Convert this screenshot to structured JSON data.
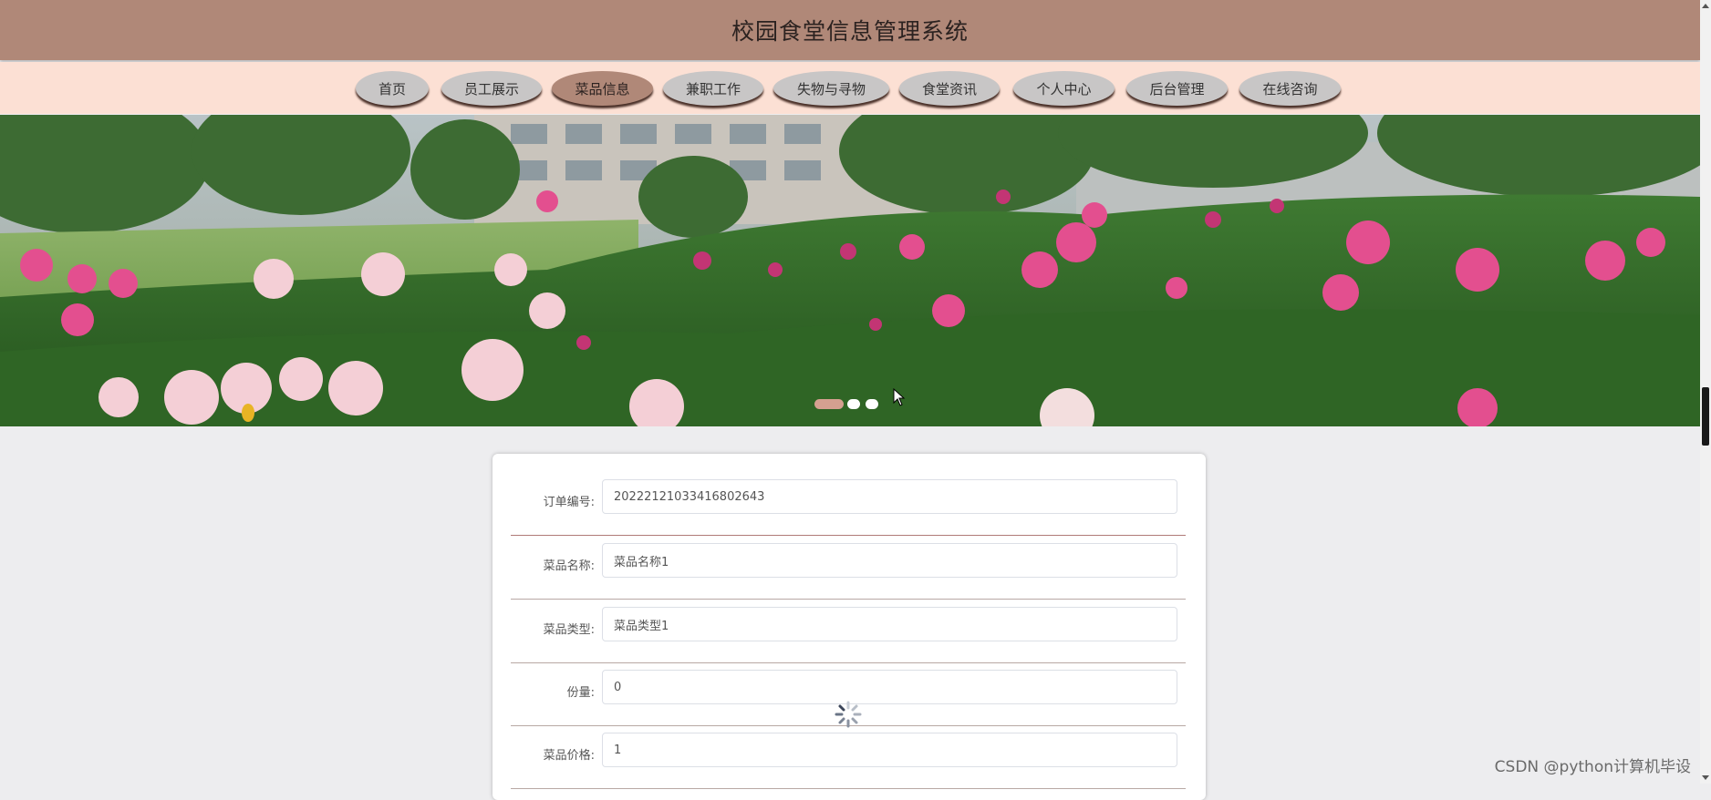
{
  "header": {
    "title": "校园食堂信息管理系统"
  },
  "nav": {
    "items": [
      {
        "label": "首页"
      },
      {
        "label": "员工展示"
      },
      {
        "label": "菜品信息"
      },
      {
        "label": "兼职工作"
      },
      {
        "label": "失物与寻物"
      },
      {
        "label": "食堂资讯"
      },
      {
        "label": "个人中心"
      },
      {
        "label": "后台管理"
      },
      {
        "label": "在线咨询"
      }
    ],
    "active_index": 2
  },
  "banner": {
    "slide_count": 3,
    "active_slide": 0
  },
  "form": {
    "fields": [
      {
        "label": "订单编号:",
        "value": "20222121033416802643"
      },
      {
        "label": "菜品名称:",
        "value": "菜品名称1"
      },
      {
        "label": "菜品类型:",
        "value": "菜品类型1"
      },
      {
        "label": "份量:",
        "value": "0"
      },
      {
        "label": "菜品价格:",
        "value": "1"
      }
    ]
  },
  "watermark": "CSDN @python计算机毕设",
  "colors": {
    "header_bg": "#b08878",
    "nav_bg": "#fce0d4",
    "nav_active": "#b08878",
    "nav_inactive": "#c8c6c6",
    "page_bg": "#ededef"
  }
}
